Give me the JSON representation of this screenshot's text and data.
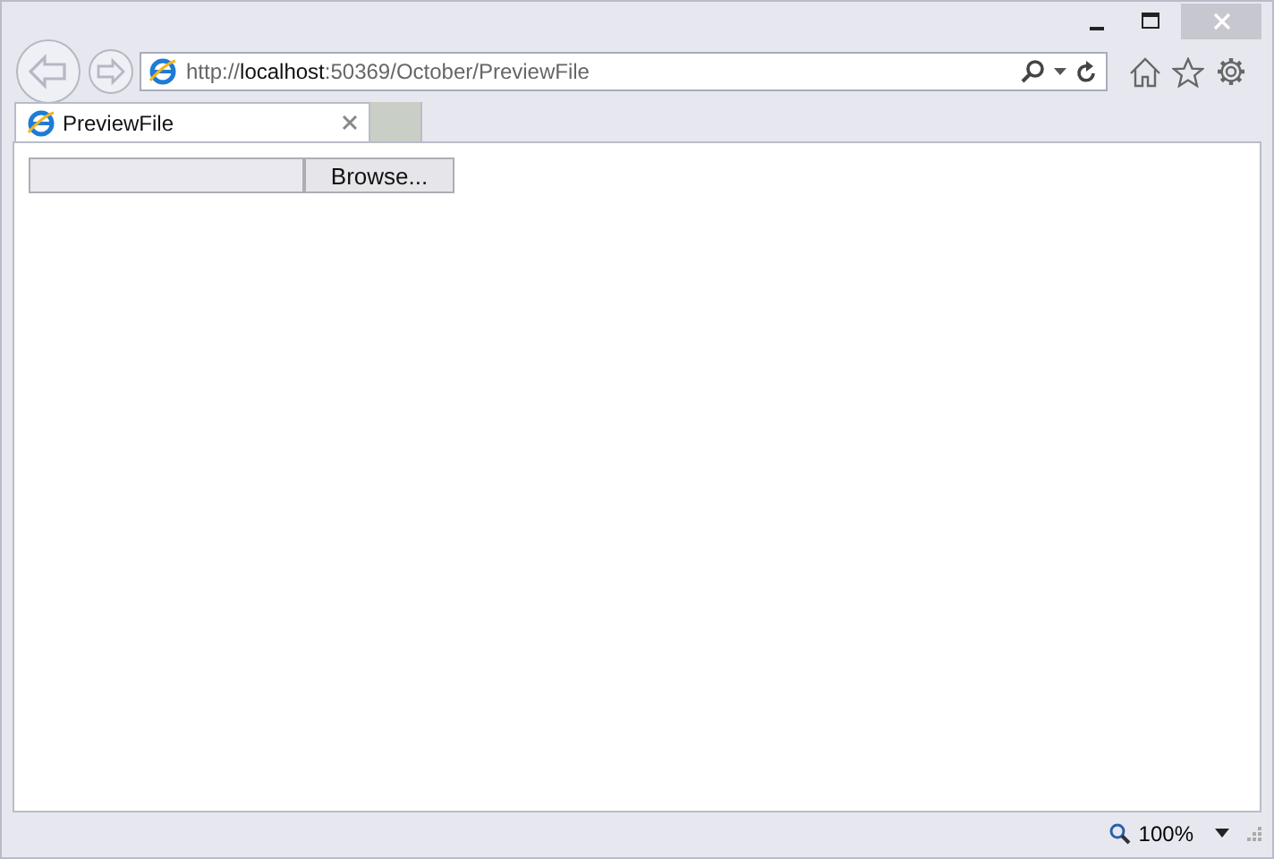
{
  "address_bar": {
    "scheme": "http://",
    "host": "localhost",
    "path": ":50369/October/PreviewFile"
  },
  "tabs": [
    {
      "title": "PreviewFile",
      "selected": true
    }
  ],
  "file_input": {
    "button": "Browse..."
  },
  "status_bar": {
    "zoom": "100%"
  }
}
